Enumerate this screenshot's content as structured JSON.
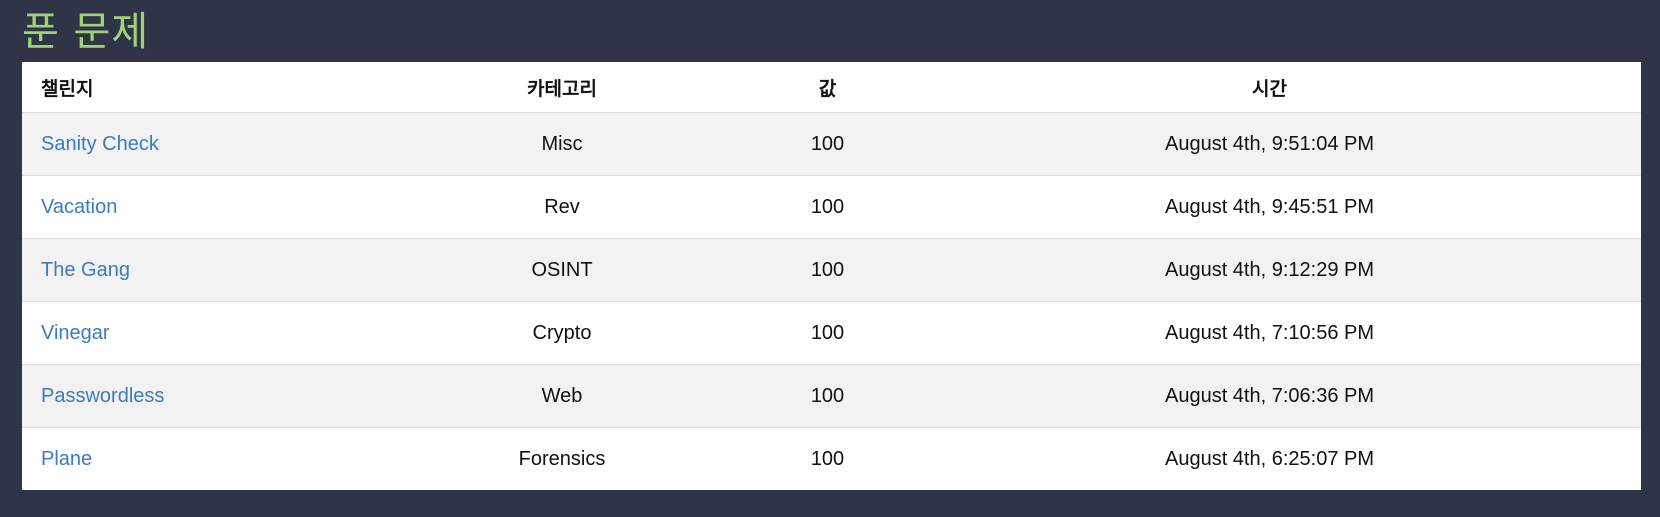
{
  "page": {
    "title": "푼 문제"
  },
  "table": {
    "headers": {
      "challenge": "챌린지",
      "category": "카테고리",
      "value": "값",
      "time": "시간"
    },
    "rows": [
      {
        "challenge": "Sanity Check",
        "category": "Misc",
        "value": "100",
        "time": "August 4th, 9:51:04 PM"
      },
      {
        "challenge": "Vacation",
        "category": "Rev",
        "value": "100",
        "time": "August 4th, 9:45:51 PM"
      },
      {
        "challenge": "The Gang",
        "category": "OSINT",
        "value": "100",
        "time": "August 4th, 9:12:29 PM"
      },
      {
        "challenge": "Vinegar",
        "category": "Crypto",
        "value": "100",
        "time": "August 4th, 7:10:56 PM"
      },
      {
        "challenge": "Passwordless",
        "category": "Web",
        "value": "100",
        "time": "August 4th, 7:06:36 PM"
      },
      {
        "challenge": "Plane",
        "category": "Forensics",
        "value": "100",
        "time": "August 4th, 6:25:07 PM"
      }
    ]
  },
  "colors": {
    "background": "#2f3447",
    "title": "#9ed479",
    "link": "#3b7bbf",
    "stripe": "#f2f2f2"
  }
}
